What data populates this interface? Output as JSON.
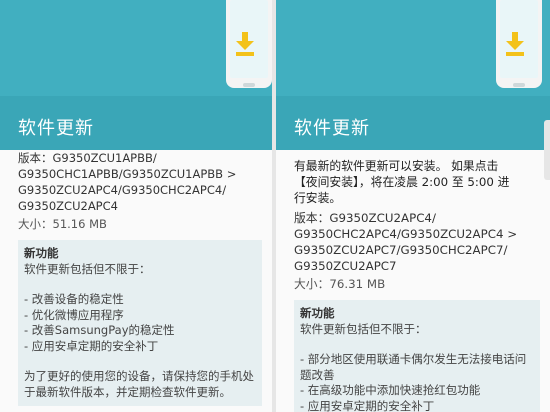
{
  "left": {
    "title": "软件更新",
    "version_lines": [
      "版本：G9350ZCU1APBB/",
      "G9350CHC1APBB/G9350ZCU1APBB >",
      "G9350ZCU2APC4/G9350CHC2APC4/",
      "G9350ZCU2APC4"
    ],
    "size": "大小：51.16 MB",
    "card": {
      "title": "新功能",
      "intro": "软件更新包括但不限于：",
      "items": [
        "- 改善设备的稳定性",
        "- 优化微博应用程序",
        "- 改善SamsungPay的稳定性",
        "- 应用安卓定期的安全补丁"
      ],
      "footer_lines": [
        "为了更好的使用您的设备，请保持您的手机处",
        "于最新软件版本，并定期检查软件更新。"
      ]
    }
  },
  "right": {
    "title": "软件更新",
    "intro_lines": [
      "有最新的软件更新可以安装。 如果点击",
      "【夜间安装】，将在凌晨 2:00 至 5:00 进",
      "行安装。"
    ],
    "version_lines": [
      "版本：G9350ZCU2APC4/",
      "G9350CHC2APC4/G9350ZCU2APC4 >",
      "G9350ZCU2APC7/G9350CHC2APC7/",
      "G9350ZCU2APC7"
    ],
    "size": "大小：76.31 MB",
    "card": {
      "title": "新功能",
      "intro": "软件更新包括但不限于：",
      "items": [
        "- 部分地区使用联通卡偶尔发生无法接电话问",
        "题改善",
        "- 在高级功能中添加快速抢红包功能",
        "- 应用安卓定期的安全补丁"
      ]
    }
  },
  "icons": {
    "download": "download-icon",
    "phone": "phone-illustration"
  },
  "colors": {
    "header": "#3aa6b7",
    "header_top": "#41afc0",
    "card_bg": "#e6eff1",
    "download_arrow": "#f3c21a"
  }
}
